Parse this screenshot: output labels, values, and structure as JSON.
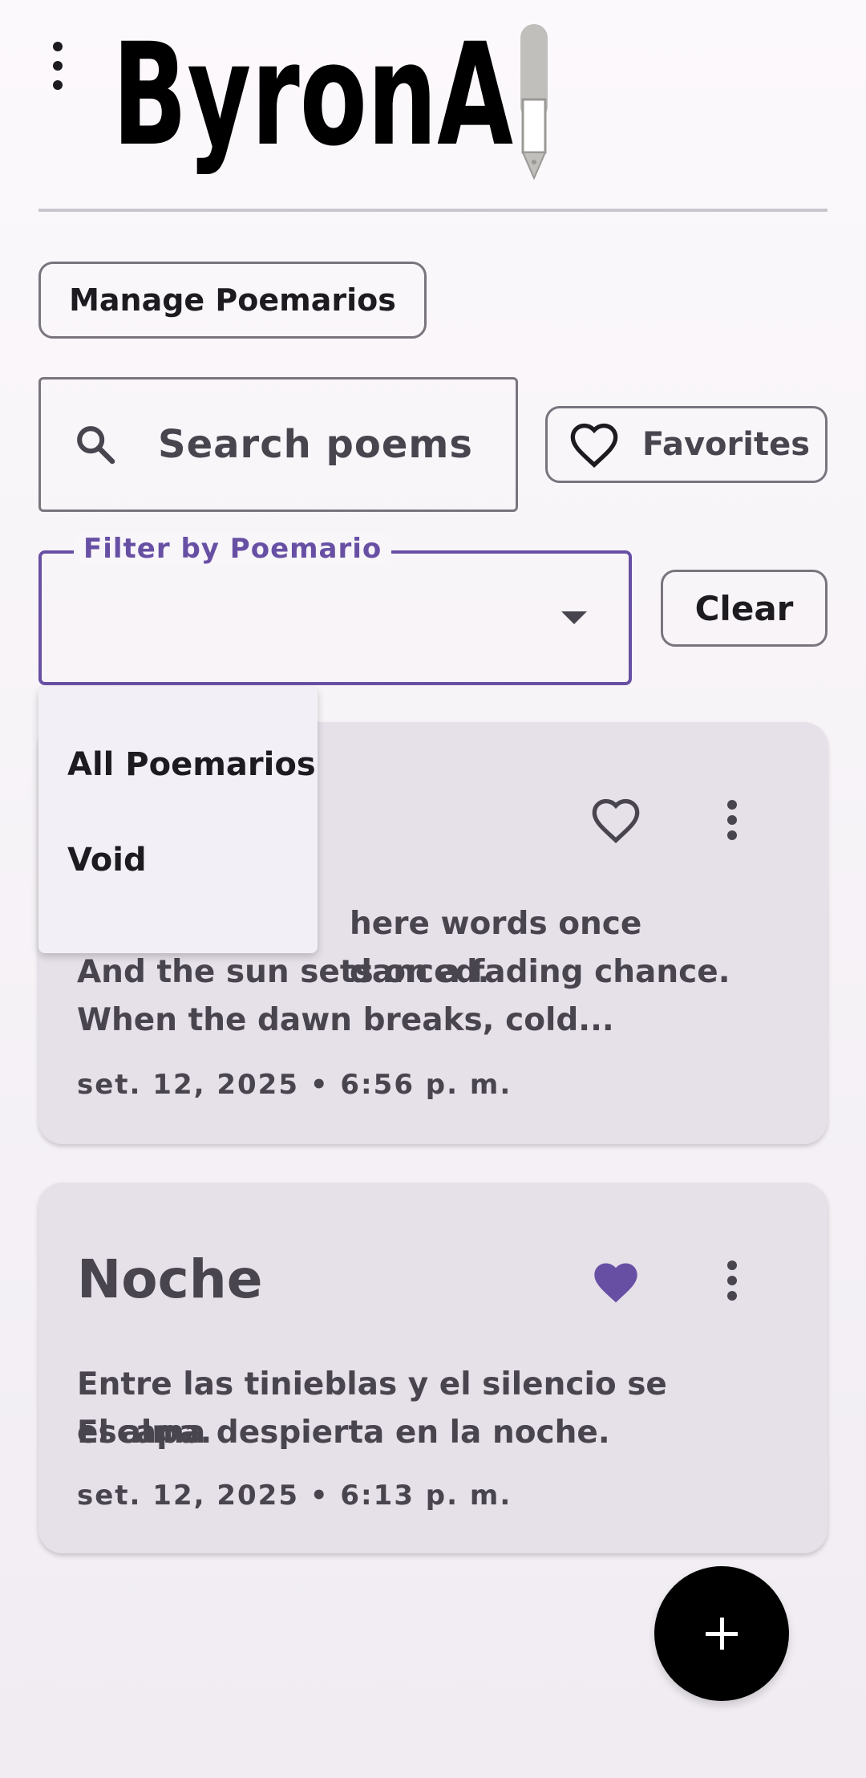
{
  "header": {
    "logo_text": "ByronAI"
  },
  "toolbar": {
    "manage_label": "Manage Poemarios",
    "search_placeholder": "Search poems",
    "favorites_label": "Favorites",
    "clear_label": "Clear"
  },
  "filter": {
    "label": "Filter by Poemario",
    "value": "",
    "options": [
      "All Poemarios",
      "Void"
    ]
  },
  "poems": [
    {
      "title": "",
      "body_lines": [
        "here words once danced.",
        "And the sun sets on a fading chance.",
        "When the dawn breaks, cold..."
      ],
      "date": "set. 12, 2025 • 6:56 p. m.",
      "favorite": false
    },
    {
      "title": "Noche",
      "body_lines": [
        "Entre las tinieblas y el silencio se escapa.",
        "El alma despierta en la noche."
      ],
      "date": "set. 12, 2025 • 6:13 p. m.",
      "favorite": true
    }
  ],
  "icons": {
    "menu": "more-vert-icon",
    "search": "search-icon",
    "favorite_outline": "heart-outline-icon",
    "favorite_filled": "heart-filled-icon",
    "more": "more-vert-icon",
    "caret": "arrow-drop-down-icon",
    "add": "plus-icon",
    "logo_pen": "fountain-pen-icon"
  },
  "colors": {
    "accent": "#6750a4",
    "card_bg": "#e6e0e9",
    "fab_bg": "#000000"
  }
}
